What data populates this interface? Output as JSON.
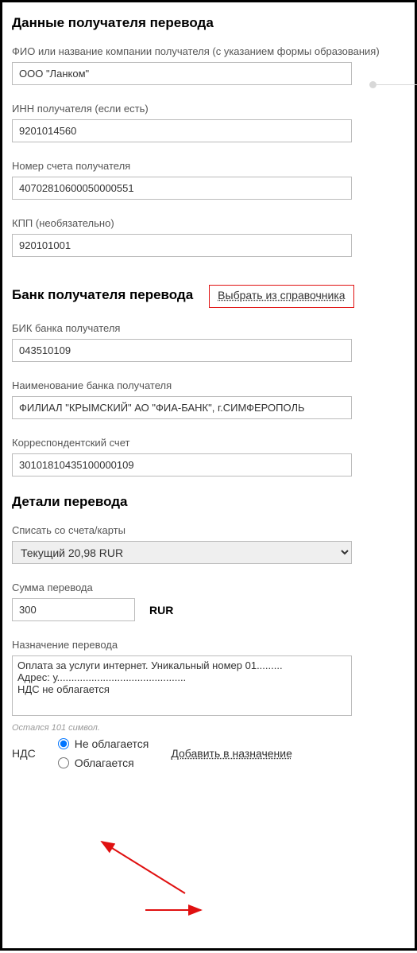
{
  "recipient": {
    "section_title": "Данные получателя перевода",
    "name_label": "ФИО или название компании получателя (с указанием формы образования)",
    "name_value": "ООО \"Ланком\"",
    "inn_label": "ИНН получателя (если есть)",
    "inn_value": "9201014560",
    "account_label": "Номер счета получателя",
    "account_value": "40702810600050000551",
    "kpp_label": "КПП (необязательно)",
    "kpp_value": "920101001"
  },
  "bank": {
    "section_title": "Банк получателя перевода",
    "select_link": "Выбрать из справочника",
    "bik_label": "БИК банка получателя",
    "bik_value": "043510109",
    "bank_name_label": "Наименование банка получателя",
    "bank_name_value": "ФИЛИАЛ \"КРЫМСКИЙ\" АО \"ФИА-БАНК\", г.СИМФЕРОПОЛЬ",
    "corr_label": "Корреспондентский счет",
    "corr_value": "30101810435100000109"
  },
  "details": {
    "section_title": "Детали перевода",
    "account_label": "Списать со счета/карты",
    "account_value": "Текущий 20,98 RUR",
    "amount_label": "Сумма перевода",
    "amount_value": "300",
    "currency": "RUR",
    "purpose_label": "Назначение перевода",
    "purpose_value": "Оплата за услуги интернет. Уникальный номер 01.........\nАдрес: у.............................................\nНДС не облагается",
    "chars_left": "Остался 101 символ."
  },
  "nds": {
    "label": "НДС",
    "option_no": "Не облагается",
    "option_yes": "Облагается",
    "add_link": "Добавить в назначение"
  }
}
